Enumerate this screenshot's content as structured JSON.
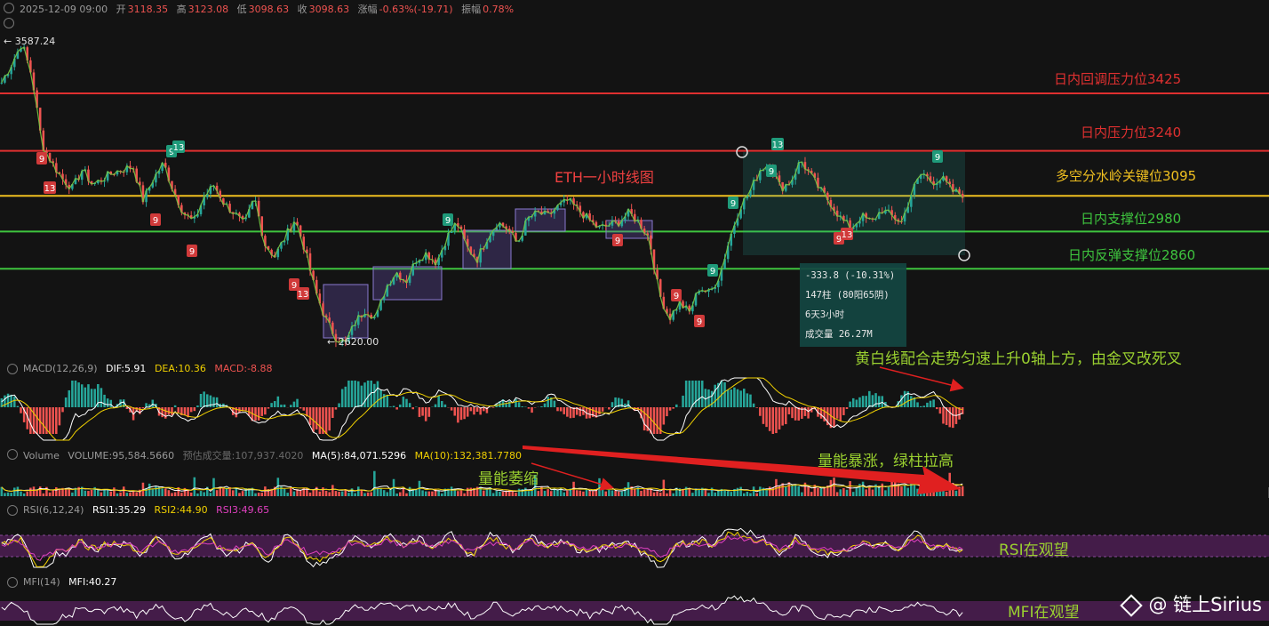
{
  "header": {
    "datetime": "2025-12-09 09:00",
    "open_label": "开",
    "open": "3118.35",
    "high_label": "高",
    "high": "3123.08",
    "low_label": "低",
    "low": "3098.63",
    "close_label": "收",
    "close": "3098.63",
    "change_label": "涨幅",
    "change": "-0.63%(-19.71)",
    "amplitude_label": "振幅",
    "amplitude": "0.78%"
  },
  "main": {
    "title_annotation": "ETH一小时线图",
    "high_marker": "← 3587.24",
    "low_marker": "← 2620.00",
    "levels": [
      {
        "label": "日内回调压力位3425",
        "value": 3425,
        "color": "#e03030"
      },
      {
        "label": "日内压力位3240",
        "value": 3240,
        "color": "#e03030"
      },
      {
        "label": "多空分水岭关键位3095",
        "value": 3095,
        "color": "#f0c020"
      },
      {
        "label": "日内支撑位2980",
        "value": 2980,
        "color": "#3ec43e"
      },
      {
        "label": "日内反弹支撑位2860",
        "value": 2860,
        "color": "#3ec43e"
      }
    ],
    "measure": {
      "line1": "-333.8 (-10.31%)",
      "line2": "147柱 (80阳65阴)",
      "line3": "6天3小时",
      "line4": "成交量 26.27M"
    }
  },
  "macd": {
    "label": "MACD(12,26,9)",
    "dif": "DIF:5.91",
    "dea": "DEA:10.36",
    "macd": "MACD:-8.88",
    "annotation": "黄白线配合走势匀速上升0轴上方，由金叉改死叉"
  },
  "volume": {
    "label": "Volume",
    "volume": "VOLUME:95,584.5660",
    "predicted": "预估成交量:107,937.4020",
    "ma5": "MA(5):84,071.5296",
    "ma10": "MA(10):132,381.7780",
    "annotation_left": "量能萎缩",
    "annotation_right": "量能暴涨，绿柱拉高"
  },
  "rsi": {
    "label": "RSI(6,12,24)",
    "rsi1": "RSI1:35.29",
    "rsi2": "RSI2:44.90",
    "rsi3": "RSI3:49.65",
    "annotation": "RSI在观望"
  },
  "mfi": {
    "label": "MFI(14)",
    "mfi": "MFI:40.27",
    "annotation": "MFI在观望"
  },
  "watermark": "@ 链上Sirius",
  "colors": {
    "up": "#26a69a",
    "down": "#ef5350",
    "bg": "#131313",
    "yellow": "#f0d000",
    "magenta": "#e040c0"
  },
  "chart_data": {
    "type": "candlestick",
    "title": "ETH一小时线图",
    "ylim": [
      2580,
      3640
    ],
    "marked_high": 3587.24,
    "marked_low": 2620.0,
    "last_close": 3098.63,
    "horizontal_levels": [
      3425,
      3240,
      3095,
      2980,
      2860
    ],
    "td_markers": [
      {
        "label": "9",
        "type": "sell"
      },
      {
        "label": "13",
        "type": "sell"
      },
      {
        "label": "9",
        "type": "buy"
      },
      {
        "label": "13",
        "type": "buy"
      }
    ],
    "price_path": [
      3460,
      3520,
      3587,
      3480,
      3260,
      3200,
      3150,
      3120,
      3180,
      3130,
      3150,
      3170,
      3180,
      3190,
      3080,
      3150,
      3200,
      3110,
      3040,
      3010,
      3090,
      3130,
      3070,
      3040,
      3000,
      3090,
      2940,
      2900,
      2960,
      3020,
      2920,
      2790,
      2700,
      2640,
      2620,
      2690,
      2730,
      2700,
      2800,
      2850,
      2820,
      2890,
      2910,
      2880,
      2960,
      3010,
      2930,
      2890,
      2960,
      3010,
      2990,
      2940,
      3020,
      3040,
      3030,
      3060,
      3080,
      3050,
      3020,
      2990,
      3000,
      3010,
      3040,
      3010,
      2960,
      2780,
      2700,
      2750,
      2720,
      2800,
      2780,
      2840,
      2960,
      3060,
      3110,
      3180,
      3200,
      3120,
      3140,
      3210,
      3160,
      3110,
      3070,
      3020,
      2990,
      3030,
      3010,
      3050,
      3030,
      3010,
      3110,
      3170,
      3140,
      3150,
      3110,
      3100
    ]
  }
}
